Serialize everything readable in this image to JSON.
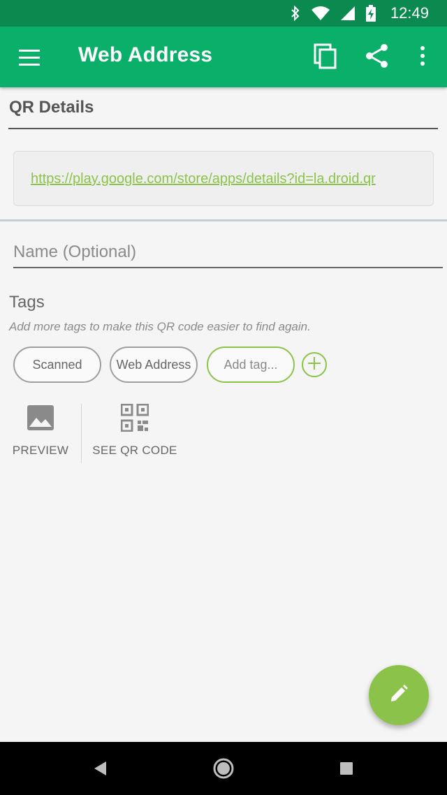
{
  "status_bar": {
    "time": "12:49",
    "icons": [
      "bluetooth-icon",
      "wifi-icon",
      "signal-icon",
      "battery-charging-icon"
    ]
  },
  "app_bar": {
    "title": "Web Address",
    "actions": [
      "menu-icon",
      "copy-icon",
      "share-icon",
      "more-vert-icon"
    ]
  },
  "qr_details": {
    "heading": "QR Details",
    "url": "https://play.google.com/store/apps/details?id=la.droid.qr"
  },
  "name_field": {
    "placeholder": "Name (Optional)",
    "value": ""
  },
  "tags": {
    "title": "Tags",
    "hint": "Add more tags to make this QR code easier to find again.",
    "chips": [
      "Scanned",
      "Web Address"
    ],
    "add_placeholder": "Add tag..."
  },
  "actions": {
    "preview_label": "PREVIEW",
    "qr_label": "SEE QR CODE"
  },
  "colors": {
    "status_bar": "#0b8a4f",
    "app_bar": "#0ab06a",
    "accent": "#8bc34a",
    "background": "#f5f5f5"
  }
}
